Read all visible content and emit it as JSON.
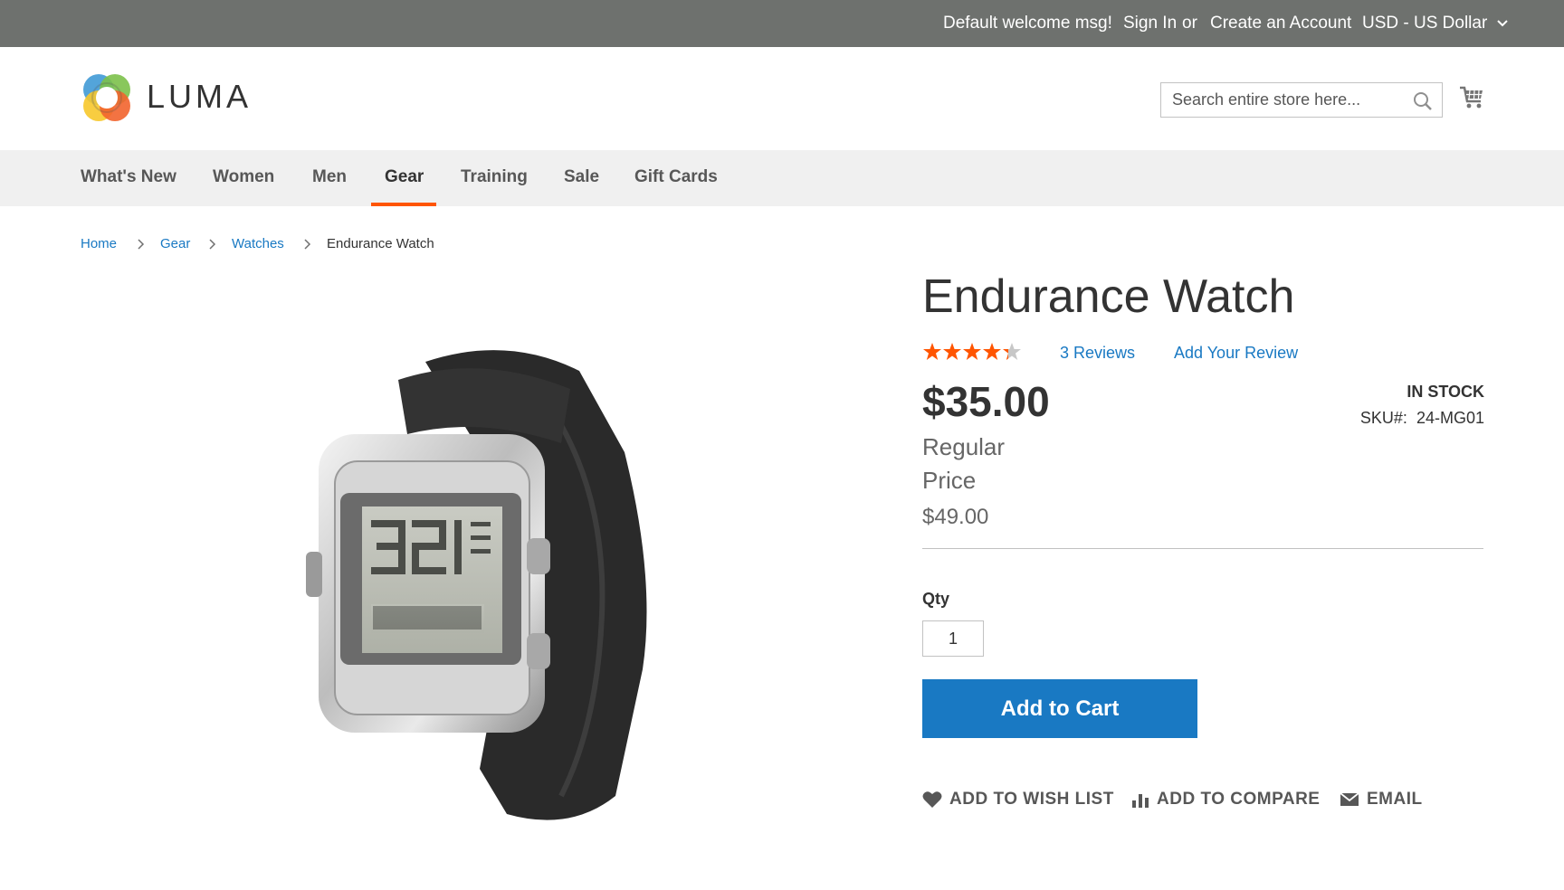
{
  "header_panel": {
    "welcome": "Default welcome msg!",
    "sign_in": "Sign In",
    "or": "or",
    "create_account": "Create an Account",
    "currency": "USD - US Dollar"
  },
  "header": {
    "logo_text": "LUMA",
    "search_placeholder": "Search entire store here..."
  },
  "nav": {
    "items": [
      {
        "label": "What's New"
      },
      {
        "label": "Women"
      },
      {
        "label": "Men"
      },
      {
        "label": "Gear",
        "active": true
      },
      {
        "label": "Training"
      },
      {
        "label": "Sale"
      },
      {
        "label": "Gift Cards"
      }
    ]
  },
  "breadcrumbs": {
    "items": [
      {
        "label": "Home"
      },
      {
        "label": "Gear"
      },
      {
        "label": "Watches"
      },
      {
        "label": "Endurance Watch"
      }
    ]
  },
  "product": {
    "name": "Endurance Watch",
    "rating": 4.3,
    "rating_max": 5,
    "review_count": "3",
    "reviews_label": "Reviews",
    "add_review": "Add Your Review",
    "price": "$35.00",
    "regular_price_label": "Regular Price",
    "regular_price": "$49.00",
    "stock": "IN STOCK",
    "sku_label": "SKU#:",
    "sku": "24-MG01",
    "qty_label": "Qty",
    "qty": "1",
    "add_to_cart": "Add to Cart"
  },
  "actions": {
    "wishlist": "ADD TO WISH LIST",
    "compare": "ADD TO COMPARE",
    "email": "EMAIL"
  },
  "colors": {
    "topbar": "#6e716e",
    "link": "#1979c3",
    "nav_active_underline": "#ff5501",
    "star": "#ff5501",
    "button": "#1979c3"
  }
}
